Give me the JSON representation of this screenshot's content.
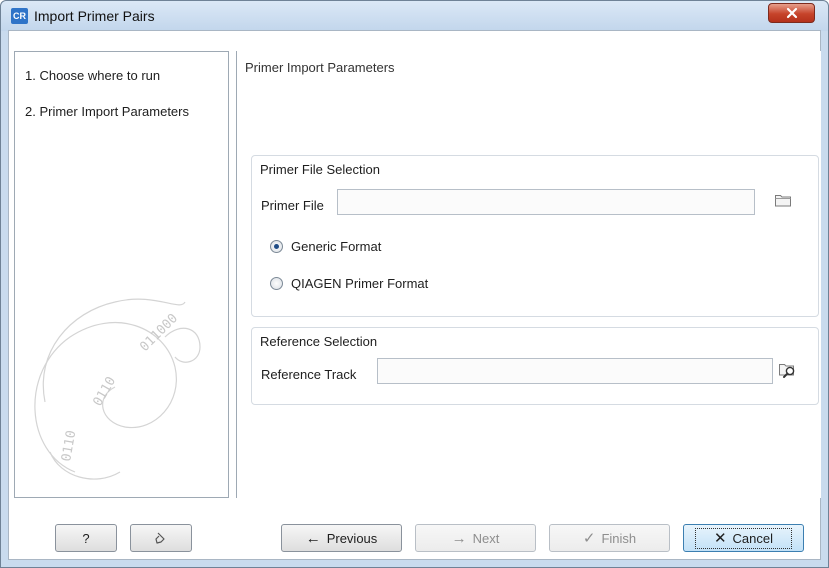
{
  "window": {
    "app_icon_text": "CR",
    "title": "Import Primer Pairs",
    "close_glyph": "x"
  },
  "steps": [
    {
      "label": "1.  Choose where to run"
    },
    {
      "label": "2.  Primer Import Parameters"
    }
  ],
  "content": {
    "heading": "Primer Import Parameters",
    "primer_file_group": {
      "title": "Primer File Selection",
      "field_label": "Primer File",
      "field_value": "",
      "browse_icon": "folder-icon",
      "options": [
        {
          "label": "Generic Format",
          "checked": true
        },
        {
          "label": "QIAGEN Primer Format",
          "checked": false
        }
      ]
    },
    "reference_group": {
      "title": "Reference Selection",
      "field_label": "Reference Track",
      "field_value": "",
      "browse_icon": "folder-search-icon"
    }
  },
  "buttons": {
    "help": "?",
    "reset_icon": "reset-icon",
    "previous": "Previous",
    "next": "Next",
    "finish": "Finish",
    "cancel": "Cancel"
  },
  "colors": {
    "titlebar": "#c9dbee",
    "close": "#c6432a",
    "primary_button": "#c2e1f7"
  }
}
